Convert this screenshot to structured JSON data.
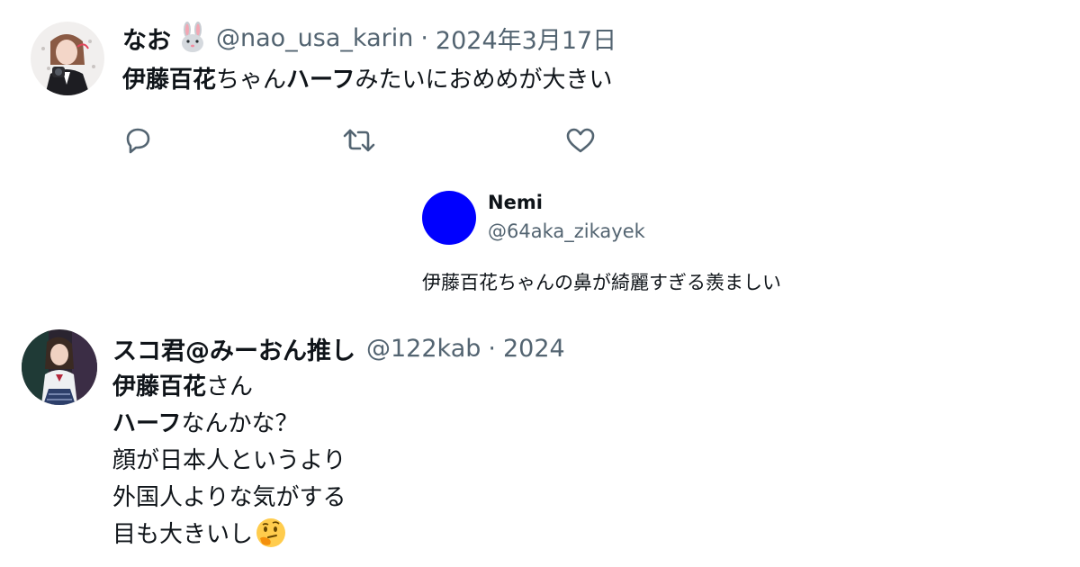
{
  "tweet1": {
    "author_name": "なお",
    "name_emoji": "rabbit-face-emoji",
    "handle": "@nao_usa_karin",
    "separator": "·",
    "date": "2024年3月17日",
    "body": {
      "part1": "伊藤百花",
      "part2": "ちゃん",
      "part3": "ハーフ",
      "part4": "みたいにおめめが大きい"
    },
    "actions": [
      "reply-icon",
      "retweet-icon",
      "like-icon"
    ]
  },
  "nemi": {
    "name": "Nemi",
    "handle": "@64aka_zikayek",
    "text": "伊藤百花ちゃんの鼻が綺麗すぎる羨ましい",
    "avatar_color": "#0000ff"
  },
  "tweet2": {
    "author_name": "スコ君@みーおん推し",
    "handle": "@122kab",
    "separator": "·",
    "date_truncated": "2024",
    "lines": {
      "l1a": "伊藤百花",
      "l1b": "さん",
      "l2a": "ハーフ",
      "l2b": "なんかな？",
      "l3": "顔が日本人というより",
      "l4": "外国人よりな気がする",
      "l5": "目も大きいし"
    },
    "end_emoji": "thinking-face-emoji"
  },
  "colors": {
    "text_primary": "#0f1419",
    "text_secondary": "#536471"
  }
}
